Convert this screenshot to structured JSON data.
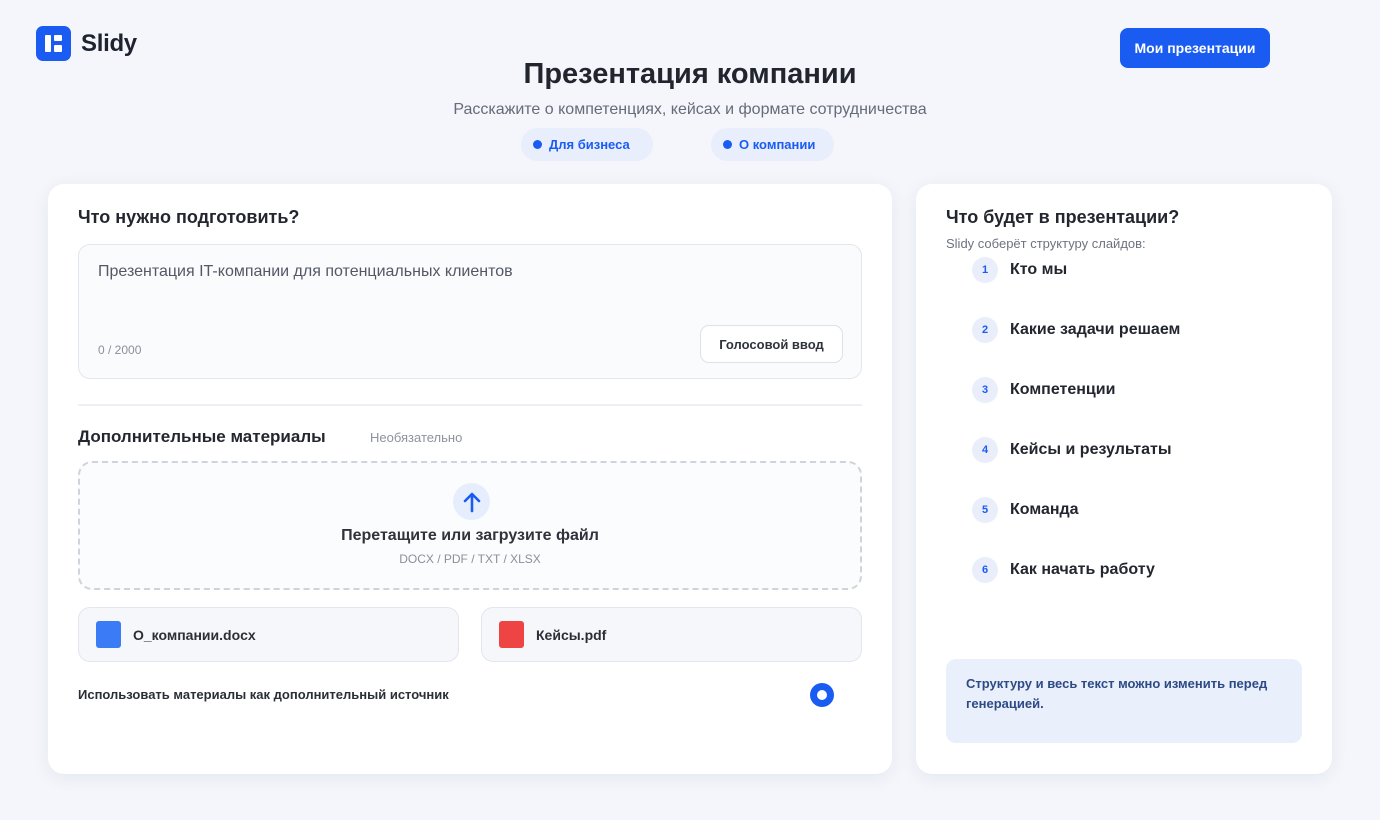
{
  "header": {
    "logo_text": "Slidy",
    "my_presentations_label": "Мои презентации"
  },
  "hero": {
    "title": "Презентация компании",
    "subtitle": "Расскажите о компетенциях, кейсах и формате сотрудничества",
    "chips": [
      {
        "label": "Для бизнеса"
      },
      {
        "label": "О компании"
      }
    ]
  },
  "form": {
    "section_title": "Что нужно подготовить?",
    "prompt_text": "Презентация IT-компании для потенциальных клиентов",
    "char_counter": "0 / 2000",
    "voice_button_label": "Голосовой ввод",
    "materials": {
      "title": "Дополнительные материалы",
      "optional_label": "Необязательно",
      "dropzone_title": "Перетащите или загрузите файл",
      "dropzone_formats": "DOCX / PDF / TXT / XLSX",
      "files": [
        {
          "name": "О_компании.docx",
          "icon": "docx-file-icon",
          "color": "#3b7cf6"
        },
        {
          "name": "Кейсы.pdf",
          "icon": "pdf-file-icon",
          "color": "#ee4444"
        }
      ],
      "use_as_source_label": "Использовать материалы как дополнительный источник",
      "use_as_source_enabled": true
    }
  },
  "outline": {
    "title": "Что будет в презентации?",
    "subtitle": "Slidy соберёт структуру слайдов:",
    "items": [
      {
        "num": "1",
        "label": "Кто мы"
      },
      {
        "num": "2",
        "label": "Какие задачи решаем"
      },
      {
        "num": "3",
        "label": "Компетенции"
      },
      {
        "num": "4",
        "label": "Кейсы и результаты"
      },
      {
        "num": "5",
        "label": "Команда"
      },
      {
        "num": "6",
        "label": "Как начать работу"
      }
    ],
    "note": "Структуру и весь текст можно изменить перед генерацией."
  },
  "colors": {
    "accent": "#1a5cf2",
    "background": "#f4f6fb",
    "note_background": "#e9f0fc"
  }
}
